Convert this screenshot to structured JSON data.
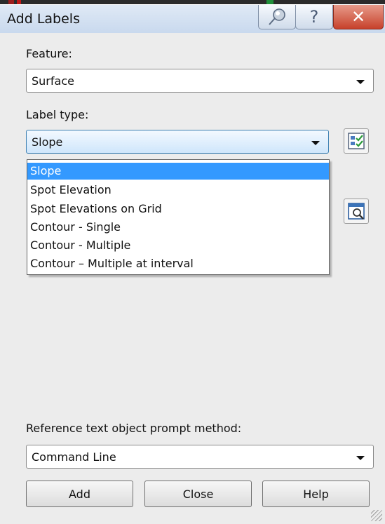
{
  "window": {
    "title": "Add Labels"
  },
  "titlebar_buttons": {
    "help_glyph": "?",
    "close_glyph": "✕",
    "pin_icon": "pushpin-icon"
  },
  "feature": {
    "label": "Feature:",
    "value": "Surface"
  },
  "label_type": {
    "label": "Label type:",
    "value": "Slope",
    "options": [
      "Slope",
      "Spot Elevation",
      "Spot Elevations on Grid",
      "Contour - Single",
      "Contour - Multiple",
      "Contour – Multiple at interval"
    ],
    "selected_index": 0
  },
  "side_icons": {
    "style_icon": "label-style-edit-icon",
    "preview_icon": "label-style-preview-icon"
  },
  "reference_prompt": {
    "label": "Reference text object prompt method:",
    "value": "Command Line"
  },
  "buttons": {
    "add": "Add",
    "close": "Close",
    "help": "Help"
  },
  "colors": {
    "selection": "#3399ff",
    "titlebar": "#c9d9ee",
    "close_button": "#c7412b"
  }
}
